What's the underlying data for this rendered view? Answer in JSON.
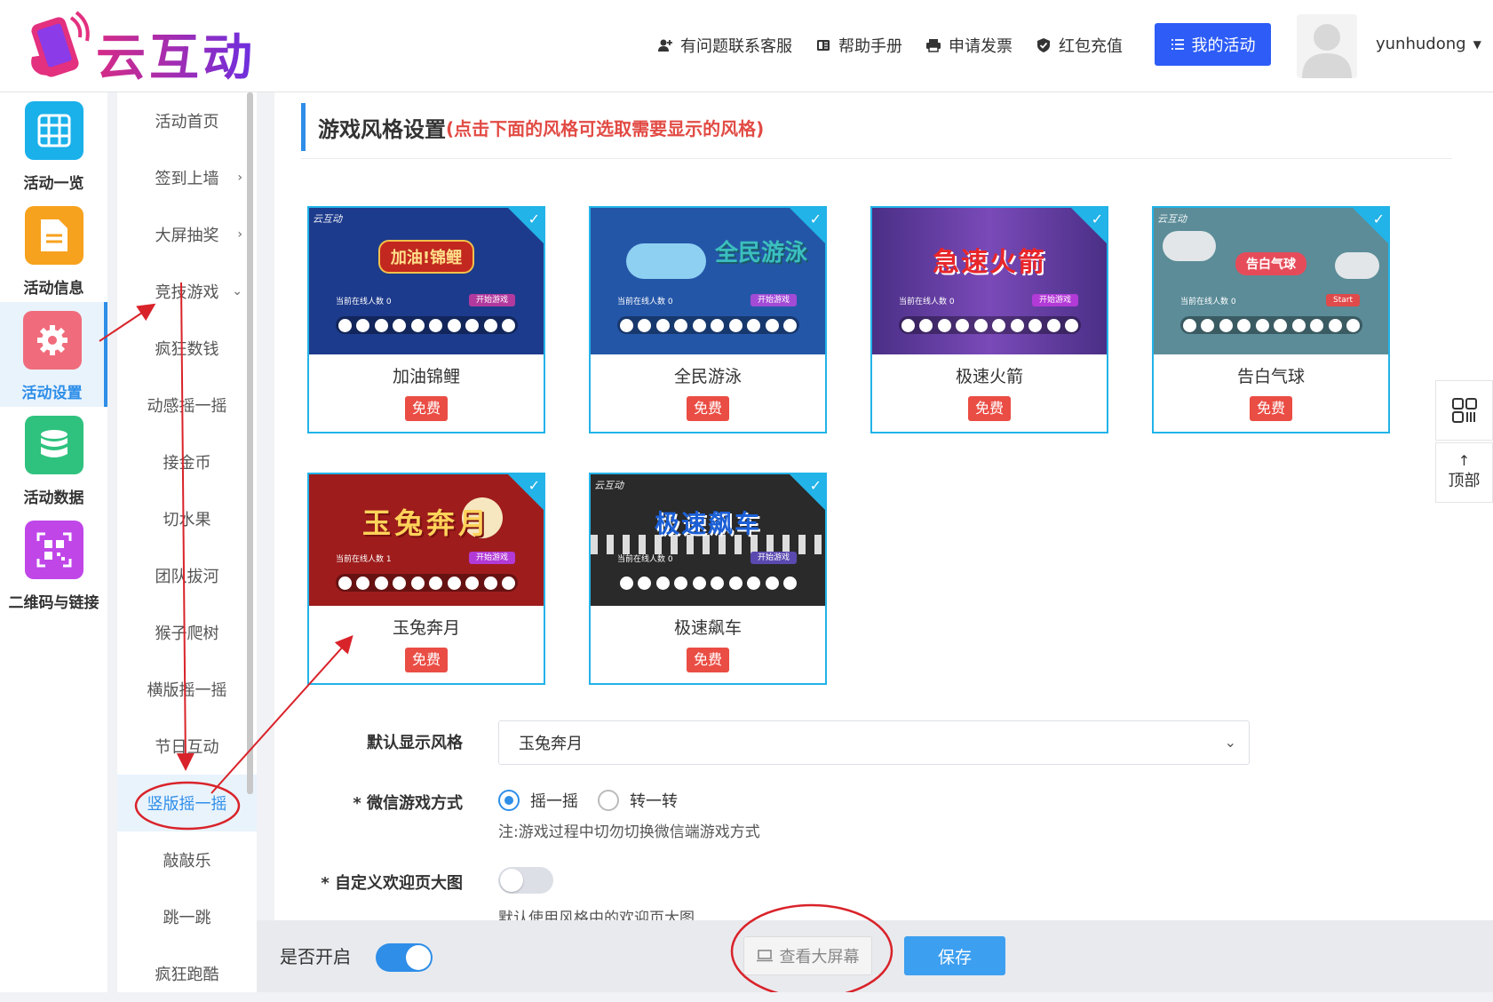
{
  "header": {
    "logo_text": "云互动",
    "nav": [
      {
        "label": "有问题联系客服",
        "icon": "user-plus-icon"
      },
      {
        "label": "帮助手册",
        "icon": "book-icon"
      },
      {
        "label": "申请发票",
        "icon": "printer-icon"
      },
      {
        "label": "红包充值",
        "icon": "shield-check-icon"
      }
    ],
    "my_activity_label": "我的活动",
    "username": "yunhudong"
  },
  "icon_sidebar": {
    "items": [
      {
        "label": "活动一览",
        "color": "#1ab0ea",
        "icon": "grid-icon"
      },
      {
        "label": "活动信息",
        "color": "#f7a21e",
        "icon": "document-icon"
      },
      {
        "label": "活动设置",
        "color": "#f06c7c",
        "icon": "gear-icon",
        "active": true
      },
      {
        "label": "活动数据",
        "color": "#2ec27e",
        "icon": "database-icon"
      },
      {
        "label": "二维码与链接",
        "color": "#c046e8",
        "icon": "qrcode-icon"
      }
    ]
  },
  "submenu": {
    "items": [
      {
        "label": "活动首页"
      },
      {
        "label": "签到上墙",
        "chevron": "›"
      },
      {
        "label": "大屏抽奖",
        "chevron": "›"
      },
      {
        "label": "竞技游戏",
        "chevron": "⌄"
      },
      {
        "label": "疯狂数钱"
      },
      {
        "label": "动感摇一摇"
      },
      {
        "label": "接金币"
      },
      {
        "label": "切水果"
      },
      {
        "label": "团队拔河"
      },
      {
        "label": "猴子爬树"
      },
      {
        "label": "横版摇一摇"
      },
      {
        "label": "节日互动"
      },
      {
        "label": "竖版摇一摇",
        "active": true
      },
      {
        "label": "敲敲乐"
      },
      {
        "label": "跳一跳"
      },
      {
        "label": "疯狂跑酷"
      }
    ]
  },
  "main": {
    "title": "游戏风格设置",
    "title_hint": "(点击下面的风格可选取需要显示的风格)",
    "free_label": "免费",
    "styles": [
      {
        "name": "加油锦鲤",
        "thumb_title": "加油!锦鲤",
        "brand": "云互动",
        "online": "当前在线人数 0",
        "start": "开始游戏",
        "bg": "#1d3b8c",
        "accent": "#b23a9e"
      },
      {
        "name": "全民游泳",
        "thumb_title": "全民游泳",
        "brand": "",
        "online": "当前在线人数 0",
        "start": "开始游戏",
        "bg": "#2456a8",
        "accent": "#a24bd6"
      },
      {
        "name": "极速火箭",
        "thumb_title": "急速火箭",
        "brand": "",
        "online": "当前在线人数 0",
        "start": "开始游戏",
        "bg": "#5c3a9e",
        "accent": "#b23ad6"
      },
      {
        "name": "告白气球",
        "thumb_title": "告白气球",
        "brand": "云互动",
        "online": "当前在线人数 0",
        "start": "Start",
        "bg": "#5b8c98",
        "accent": "#e04a4a"
      },
      {
        "name": "玉兔奔月",
        "thumb_title": "玉兔奔月",
        "brand": "",
        "online": "当前在线人数 1",
        "start": "开始游戏",
        "bg": "#9e1c1c",
        "accent": "#b23ad6"
      },
      {
        "name": "极速飙车",
        "thumb_title": "极速飙车",
        "brand": "云互动",
        "online": "当前在线人数 0",
        "start": "开始游戏",
        "bg": "#2a2a2a",
        "accent": "#5a4ab0"
      }
    ],
    "form": {
      "default_style_label": "默认显示风格",
      "default_style_value": "玉兔奔月",
      "wechat_mode_label": "* 微信游戏方式",
      "mode_options": [
        "摇一摇",
        "转一转"
      ],
      "mode_selected": "摇一摇",
      "mode_note": "注:游戏过程中切勿切换微信端游戏方式",
      "custom_welcome_label": "* 自定义欢迎页大图",
      "custom_welcome_enabled": false,
      "custom_welcome_note": "默认使用风格中的欢迎页大图"
    }
  },
  "bottom_bar": {
    "is_open_label": "是否开启",
    "is_open": true,
    "view_screen_label": "查看大屏幕",
    "save_label": "保存"
  },
  "float": {
    "qr_icon": "qrcode-outline-icon",
    "top_label": "顶部",
    "top_arrow": "↑"
  },
  "colors": {
    "primary": "#2e8ee8",
    "header_button": "#2d5cf6",
    "selected_border": "#22b3e8",
    "free_badge": "#ea4d44",
    "hint_red": "#e24b45",
    "annotation_red": "#d9232a"
  }
}
